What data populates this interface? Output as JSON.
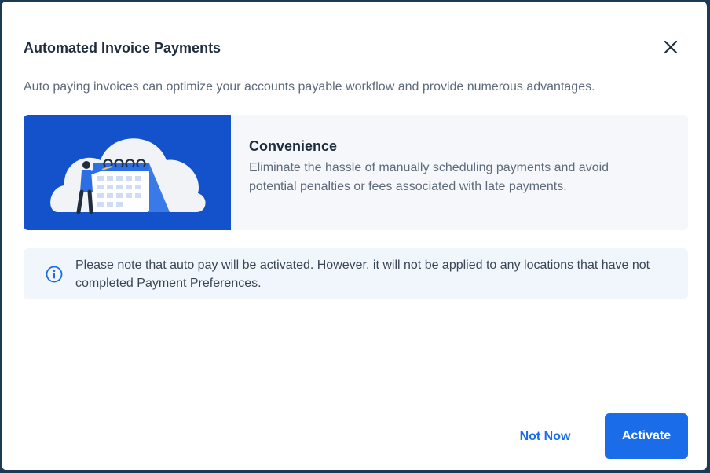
{
  "dialog": {
    "title": "Automated Invoice Payments",
    "subtitle": "Auto paying invoices can optimize your accounts payable workflow and provide numerous advantages."
  },
  "feature": {
    "title": "Convenience",
    "description": "Eliminate the hassle of manually scheduling payments and avoid potential penalties or fees associated with late payments.",
    "illustration": "person-with-calendar-illustration"
  },
  "note": {
    "icon": "info-icon",
    "text": "Please note that auto pay will be activated. However, it will not be applied to any locations that have not completed Payment Preferences."
  },
  "actions": {
    "secondary_label": "Not Now",
    "primary_label": "Activate"
  },
  "colors": {
    "primary": "#1a6ce8",
    "illustration_bg": "#1452cc",
    "note_bg": "#f1f6fd",
    "feature_bg": "#f5f7fa"
  }
}
